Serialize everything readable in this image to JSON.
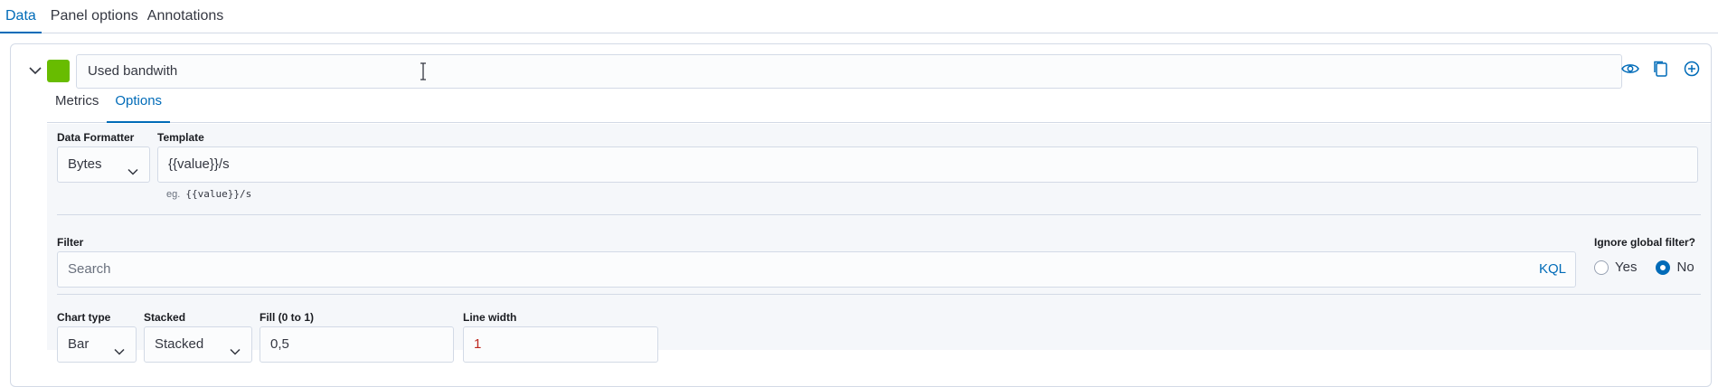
{
  "tabs": [
    "Data",
    "Panel options",
    "Annotations"
  ],
  "series": {
    "color": "#68bc00",
    "label": "Used bandwith",
    "subtabs": [
      "Metrics",
      "Options"
    ]
  },
  "options": {
    "data_formatter": {
      "label": "Data Formatter",
      "value": "Bytes"
    },
    "template": {
      "label": "Template",
      "value": "{{value}}/s",
      "hint_prefix": "eg.",
      "hint_code": "{{value}}/s"
    },
    "filter": {
      "label": "Filter",
      "placeholder": "Search",
      "kql": "KQL"
    },
    "ignore_global_filter": {
      "label": "Ignore global filter?",
      "yes": "Yes",
      "no": "No",
      "selected": "No"
    },
    "chart_type": {
      "label": "Chart type",
      "value": "Bar"
    },
    "stacked": {
      "label": "Stacked",
      "value": "Stacked"
    },
    "fill": {
      "label": "Fill (0 to 1)",
      "value": "0,5"
    },
    "line_width": {
      "label": "Line width",
      "value": "1"
    }
  },
  "icons": {
    "collapse": "chevron-down-icon",
    "toggle_visibility": "eye-icon",
    "clone": "copy-icon",
    "add": "plus-circle-icon"
  },
  "colors": {
    "accent": "#006bb8",
    "border": "#d3dae6",
    "swatch": "#68bc00",
    "line_width_value": "#bd271e"
  }
}
